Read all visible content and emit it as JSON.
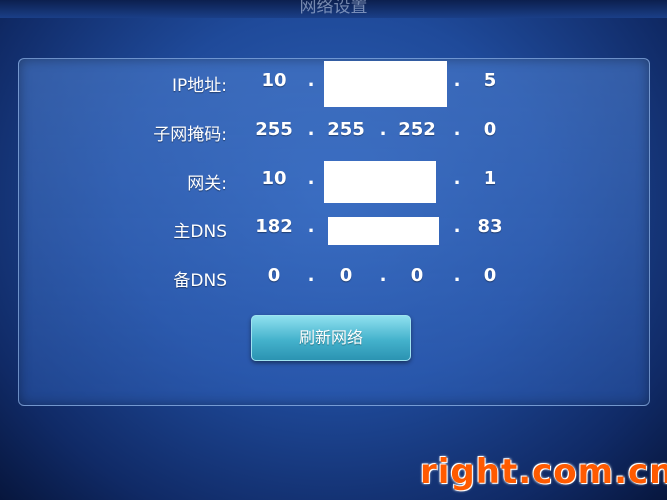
{
  "window": {
    "title": "网络设置"
  },
  "network": {
    "rows": [
      {
        "label": "IP地址:",
        "octets": [
          "10",
          "",
          "",
          "5"
        ]
      },
      {
        "label": "子网掩码:",
        "octets": [
          "255",
          "255",
          "252",
          "0"
        ]
      },
      {
        "label": "网关:",
        "octets": [
          "10",
          "",
          "",
          "1"
        ]
      },
      {
        "label": "主DNS",
        "octets": [
          "182",
          "",
          "",
          "83"
        ]
      },
      {
        "label": "备DNS",
        "octets": [
          "0",
          "0",
          "0",
          "0"
        ]
      }
    ],
    "dot": "."
  },
  "actions": {
    "refresh_label": "刷新网络"
  },
  "watermark": {
    "text": "right.com.cn"
  },
  "colors": {
    "background": "#1f4a9a",
    "button": "#44b2cc",
    "watermark": "#ff5a00"
  }
}
